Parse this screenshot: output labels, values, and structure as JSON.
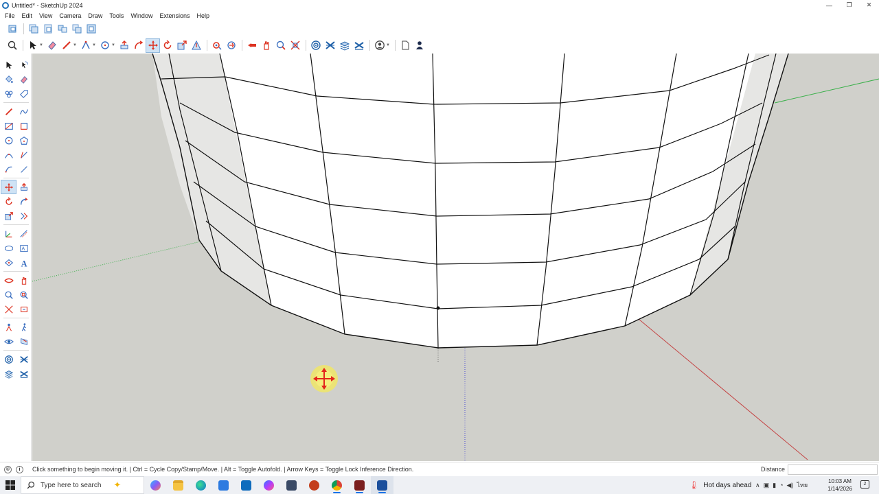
{
  "window": {
    "title": "Untitled* - SketchUp 2024",
    "controls": [
      "—",
      "❐",
      "✕"
    ]
  },
  "menu": [
    "File",
    "Edit",
    "View",
    "Camera",
    "Draw",
    "Tools",
    "Window",
    "Extensions",
    "Help"
  ],
  "toolbar_top_icons": [
    "component-icon",
    "copy-icon",
    "paste-icon",
    "group-icon",
    "layers-icon",
    "copy-stack-icon"
  ],
  "toolbar_main_icons": [
    "zoom-icon",
    "select-icon",
    "eraser-icon",
    "pencil-icon",
    "line-icon",
    "circle-icon",
    "push-pull-icon",
    "follow-me-icon",
    "move-icon",
    "rotate-icon",
    "scale-icon",
    "warning-icon",
    "section-icon",
    "offset-icon",
    "tape-measure-icon",
    "hand-icon",
    "zoom-window-icon",
    "zoom-extents-icon",
    "target-icon",
    "xray-icon",
    "layers-icon",
    "styles-icon",
    "user-icon",
    "document-icon",
    "person-icon"
  ],
  "left_toolbar_icons": [
    "select-icon",
    "lasso-icon",
    "paint-bucket-icon",
    "eraser-icon",
    "component-icon",
    "tag-icon",
    "pencil-icon",
    "freehand-icon",
    "rectangle-icon",
    "rotated-rect-icon",
    "circle-icon",
    "polygon-icon",
    "arc-icon",
    "pie-icon",
    "arc3-icon",
    "arc2-icon",
    "move-icon",
    "push-pull-icon",
    "rotate-icon",
    "follow-me-icon",
    "scale-icon",
    "offset-icon",
    "axes-icon",
    "dimension-icon",
    "tape-icon",
    "protractor-icon",
    "text-icon",
    "3d-text-icon",
    "orbit-icon",
    "pan-icon",
    "zoom-icon",
    "zoom-window-icon",
    "zoom-extents-icon",
    "previous-view-icon",
    "position-camera-icon",
    "walk-icon",
    "look-around-icon",
    "section-plane-icon",
    "target-icon",
    "xray-icon",
    "layers-icon",
    "styles-icon"
  ],
  "colors": {
    "viewport_bg": "#d0d0cb",
    "face_front": "#ffffff",
    "face_side": "#e6e6e4",
    "edge": "#111111",
    "axis_red": "#c44444",
    "axis_green": "#3ab04a",
    "axis_blue": "#4a4ad0",
    "cursor_highlight": "#f4ea5a",
    "cursor_arrows": "#e3241b"
  },
  "status": {
    "message": "Click something to begin moving it. | Ctrl = Cycle Copy/Stamp/Move. | Alt = Toggle Autofold. | Arrow Keys = Toggle Lock Inference Direction.",
    "measurement_label": "Distance",
    "measurement_value": ""
  },
  "taskbar": {
    "search_placeholder": "Type here to search",
    "apps": [
      "copilot-icon",
      "file-explorer-icon",
      "edge-icon",
      "store-icon",
      "outlook-icon",
      "messenger-icon",
      "calculator-icon",
      "powerpoint-icon",
      "chrome-icon",
      "media-icon",
      "sketchup-icon"
    ],
    "weather": "Hot days ahead",
    "clock_time": "10:03 AM",
    "clock_date": "1/14/2026",
    "tray_lang": "ไทย",
    "notification_count": "2"
  }
}
